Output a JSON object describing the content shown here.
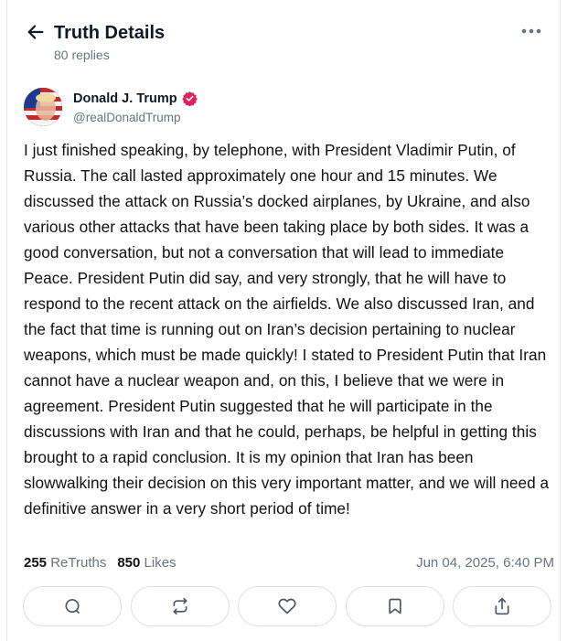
{
  "header": {
    "title": "Truth Details",
    "replies": "80 replies",
    "icons": {
      "back": "arrow-left-icon",
      "more": "more-horizontal-icon"
    }
  },
  "post": {
    "author_name": "Donald J. Trump",
    "author_handle": "@realDonaldTrump",
    "verified": true,
    "text": "I just finished speaking, by telephone, with President Vladimir Putin, of Russia. The call lasted approximately one hour and 15 minutes. We discussed the attack on Russia’s docked airplanes, by Ukraine, and also various other attacks that have been taking place by both sides. It was a good conversation, but not a conversation that will lead to immediate Peace. President Putin did say, and very strongly, that he will have to respond to the recent attack on the airfields. We also discussed Iran, and the fact that time is running out on Iran’s decision pertaining to nuclear weapons, which must be made quickly! I stated to President Putin that Iran cannot have a nuclear weapon and, on this, I believe that we were in agreement. President Putin suggested that he will participate in the discussions with Iran and that he could, perhaps, be helpful in getting this brought to a rapid conclusion. It is my opinion that Iran has been slowwalking their decision on this very important matter, and we will need a definitive answer in a very short period of time!",
    "retruths_count": "255",
    "retruths_label": "ReTruths",
    "likes_count": "850",
    "likes_label": "Likes",
    "timestamp": "Jun 04, 2025, 6:40 PM"
  },
  "actions": [
    {
      "name": "reply",
      "icon": "comment-icon"
    },
    {
      "name": "retruth",
      "icon": "repost-icon"
    },
    {
      "name": "like",
      "icon": "heart-icon"
    },
    {
      "name": "bookmark",
      "icon": "bookmark-icon"
    },
    {
      "name": "share",
      "icon": "share-icon"
    }
  ],
  "colors": {
    "verified_badge": "#e0245e",
    "muted_text": "#6b7280",
    "border": "#dcdde3"
  }
}
